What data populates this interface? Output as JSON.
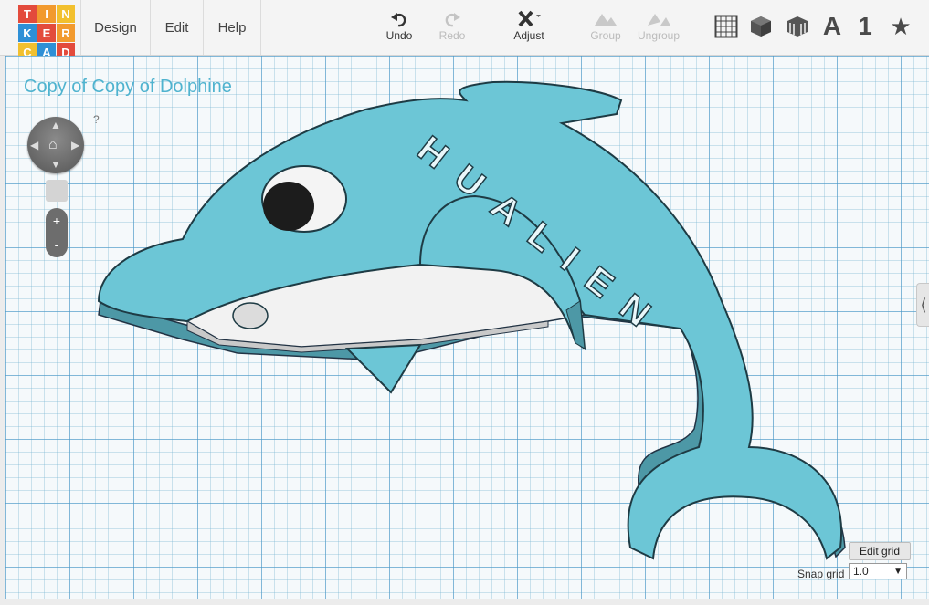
{
  "logo": {
    "letters": [
      "T",
      "I",
      "N",
      "K",
      "E",
      "R",
      "C",
      "A",
      "D"
    ]
  },
  "menu": {
    "design": "Design",
    "edit": "Edit",
    "help": "Help"
  },
  "toolbar": {
    "undo": "Undo",
    "redo": "Redo",
    "adjust": "Adjust",
    "group": "Group",
    "ungroup": "Ungroup"
  },
  "view_icons": [
    "grid-icon",
    "box-icon",
    "striped-box-icon",
    "text-icon",
    "number-icon",
    "star-icon"
  ],
  "view_labels": {
    "letter": "A",
    "number": "1"
  },
  "design": {
    "title": "Copy of Copy of Dolphine",
    "engraved_text": "HUALIEN"
  },
  "nav": {
    "help_mark": "?",
    "zoom_in": "+",
    "zoom_out": "-"
  },
  "grid": {
    "edit_label": "Edit grid",
    "snap_label": "Snap grid",
    "snap_value": "1.0"
  },
  "colors": {
    "accent": "#4fb3cf",
    "dolphin": "#6cc6d6",
    "belly": "#f2f2f2"
  }
}
